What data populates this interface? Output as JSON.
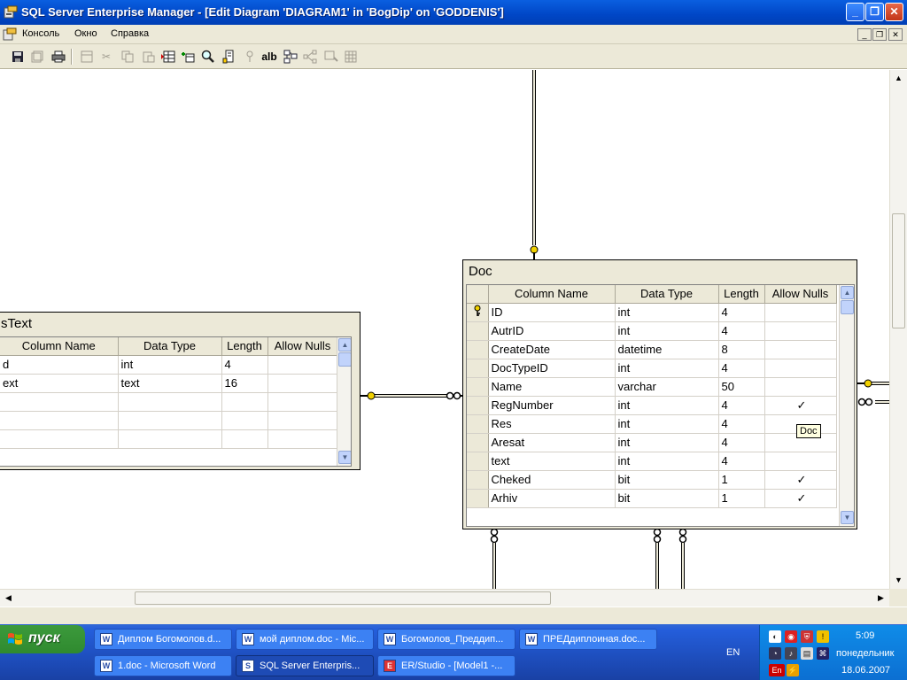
{
  "window": {
    "title": "SQL Server Enterprise Manager - [Edit Diagram 'DIAGRAM1' in 'BogDip' on 'GODDENIS']",
    "minimize": "_",
    "maximize": "❐",
    "close": "✕"
  },
  "menu": {
    "items": [
      "Консоль",
      "Окно",
      "Справка"
    ],
    "mdi_minimize": "_",
    "mdi_restore": "❐",
    "mdi_close": "✕"
  },
  "toolbar": {
    "icons": [
      "save-icon",
      "save-all-icon",
      "print-icon",
      "new-table-icon",
      "cut-icon",
      "copy-icon",
      "paste-icon",
      "insert-rows-icon",
      "add-table-icon",
      "zoom-icon",
      "properties-icon",
      "primary-key-icon",
      "show-text-icon",
      "arrange-tables-icon",
      "relationships-icon",
      "layout-icon",
      "grid-icon"
    ],
    "alb_label": "alb"
  },
  "columns": {
    "name": "Column Name",
    "type": "Data Type",
    "length": "Length",
    "nulls": "Allow Nulls"
  },
  "tables": {
    "left": {
      "name": "sText",
      "rows": [
        {
          "name": "d",
          "type": "int",
          "length": "4",
          "nulls": ""
        },
        {
          "name": "ext",
          "type": "text",
          "length": "16",
          "nulls": ""
        },
        {
          "name": "",
          "type": "",
          "length": "",
          "nulls": ""
        },
        {
          "name": "",
          "type": "",
          "length": "",
          "nulls": ""
        },
        {
          "name": "",
          "type": "",
          "length": "",
          "nulls": ""
        }
      ]
    },
    "doc": {
      "name": "Doc",
      "rows": [
        {
          "name": "ID",
          "type": "int",
          "length": "4",
          "nulls": "",
          "pk": true
        },
        {
          "name": "AutrID",
          "type": "int",
          "length": "4",
          "nulls": ""
        },
        {
          "name": "CreateDate",
          "type": "datetime",
          "length": "8",
          "nulls": ""
        },
        {
          "name": "DocTypeID",
          "type": "int",
          "length": "4",
          "nulls": ""
        },
        {
          "name": "Name",
          "type": "varchar",
          "length": "50",
          "nulls": ""
        },
        {
          "name": "RegNumber",
          "type": "int",
          "length": "4",
          "nulls": "✓"
        },
        {
          "name": "Res",
          "type": "int",
          "length": "4",
          "nulls": ""
        },
        {
          "name": "Aresat",
          "type": "int",
          "length": "4",
          "nulls": ""
        },
        {
          "name": "text",
          "type": "int",
          "length": "4",
          "nulls": ""
        },
        {
          "name": "Cheked",
          "type": "bit",
          "length": "1",
          "nulls": "✓"
        },
        {
          "name": "Arhiv",
          "type": "bit",
          "length": "1",
          "nulls": "✓"
        }
      ]
    }
  },
  "tooltip": "Doc",
  "taskbar": {
    "start": "пуск",
    "tasks_row1": [
      "Диплом Богомолов.d...",
      "мой диплом.doc - Mic...",
      "Богомолов_Преддип...",
      "ПРЕДдиплоиная.doc..."
    ],
    "tasks_row2": [
      "1.doc - Microsoft Word",
      "SQL Server Enterpris...",
      "ER/Studio - [Model1 -..."
    ],
    "lang": "EN",
    "tray_lang": "En",
    "time": "5:09",
    "day": "понедельник",
    "date": "18.06.2007"
  },
  "colors": {
    "titlebar": "#0046c6",
    "face": "#ece9d8",
    "taskbar": "#245edb",
    "start": "#2f8a2f"
  }
}
